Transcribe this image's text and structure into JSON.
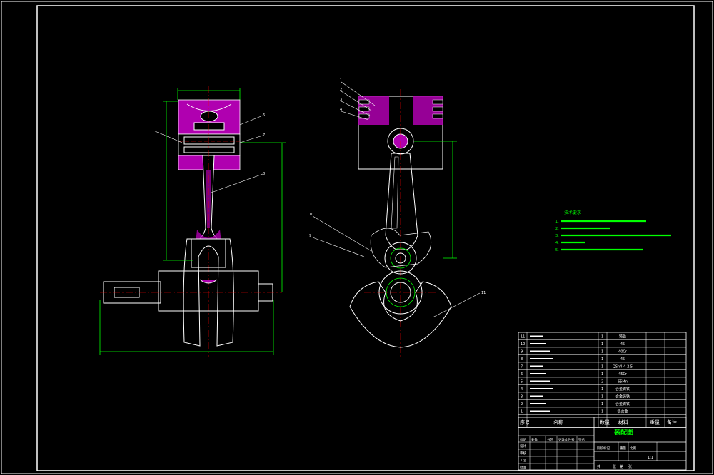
{
  "drawing": {
    "title": "装配图",
    "tech_requirements": {
      "heading": "技术要求",
      "lines": [
        "1.",
        "2.",
        "3.",
        "4.",
        "5."
      ]
    }
  },
  "bom": {
    "rows": [
      {
        "no": "11",
        "qty": "1",
        "material": "铸铁"
      },
      {
        "no": "10",
        "qty": "1",
        "material": "45"
      },
      {
        "no": "9",
        "qty": "1",
        "material": "40Cr"
      },
      {
        "no": "8",
        "qty": "1",
        "material": "45"
      },
      {
        "no": "7",
        "qty": "1",
        "material": "QSn4-4-2.5"
      },
      {
        "no": "6",
        "qty": "1",
        "material": "45Cr"
      },
      {
        "no": "5",
        "qty": "2",
        "material": "65Mn"
      },
      {
        "no": "4",
        "qty": "1",
        "material": "合金铸铁"
      },
      {
        "no": "3",
        "qty": "1",
        "material": "合金铸铁"
      },
      {
        "no": "2",
        "qty": "1",
        "material": "合金铸铁"
      },
      {
        "no": "1",
        "qty": "1",
        "material": "铝合金"
      }
    ],
    "header": {
      "seq": "序号",
      "name": "名称",
      "qty": "数量",
      "material": "材料",
      "weight": "重量",
      "remark": "备注"
    }
  },
  "title_block": {
    "scale": "1:1",
    "labels": [
      "标记",
      "处数",
      "分区",
      "更改文件号",
      "签名",
      "年月日",
      "设计",
      "审核",
      "工艺",
      "标准化",
      "批准",
      "阶段标记",
      "重量",
      "比例"
    ],
    "bottom": [
      "共",
      "张",
      "第",
      "张"
    ]
  },
  "leaders": {
    "front_view": [
      "1",
      "2",
      "3",
      "4",
      "10",
      "9"
    ],
    "side_view": [
      "6",
      "7",
      "8"
    ],
    "crank": [
      "11"
    ]
  }
}
